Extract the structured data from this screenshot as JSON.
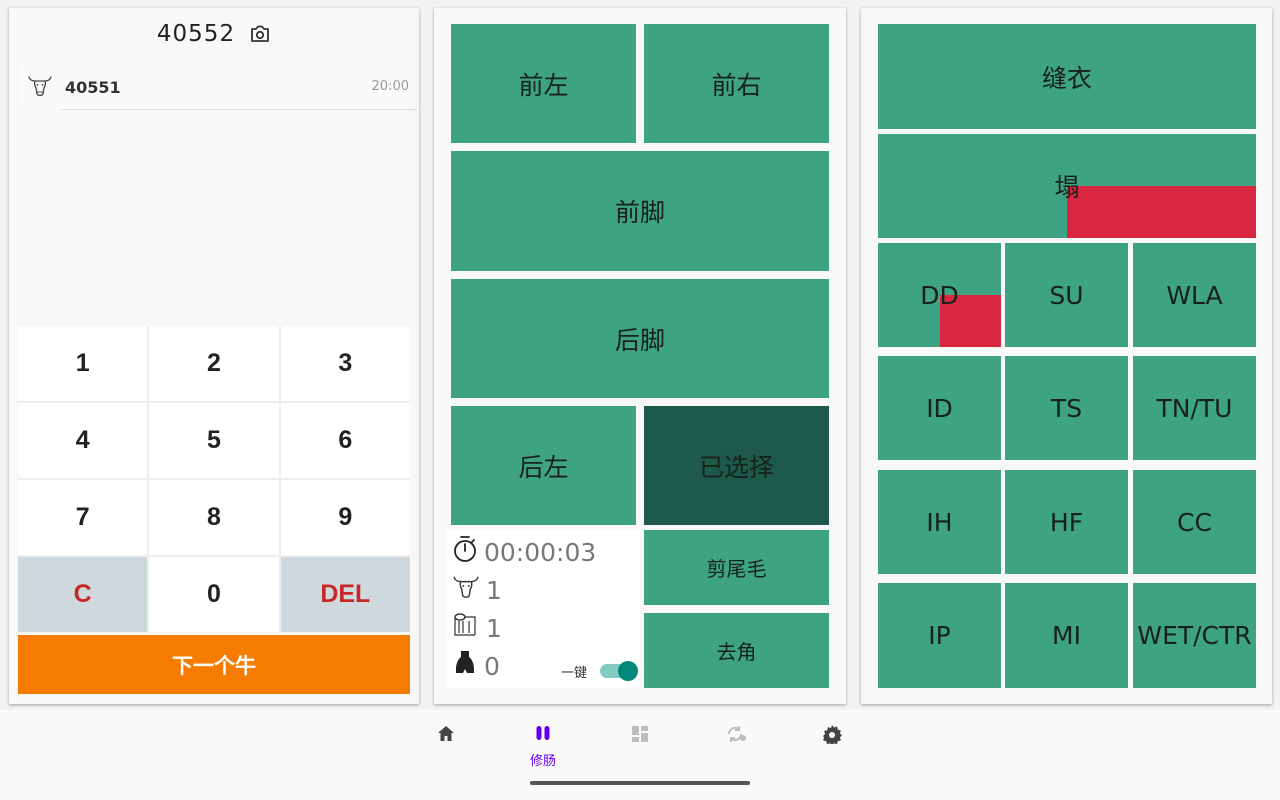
{
  "panel1": {
    "current_id": "40552",
    "entries": [
      {
        "id": "40551",
        "time": "20:00"
      }
    ],
    "keys": [
      "1",
      "2",
      "3",
      "4",
      "5",
      "6",
      "7",
      "8",
      "9",
      "C",
      "0",
      "DEL"
    ],
    "next_label": "下一个牛"
  },
  "panel2": {
    "tiles": {
      "front_left": "前左",
      "front_right": "前右",
      "front_feet": "前脚",
      "rear_feet": "后脚",
      "rear_left": "后左",
      "selected": "已选择",
      "trim_tail": "剪尾毛",
      "dehorn": "去角"
    },
    "stats": {
      "timer": "00:00:03",
      "cows": "1",
      "rolls": "1",
      "hoof": "0"
    },
    "one_key_label": "一键",
    "one_key_on": true
  },
  "panel3": {
    "tiles": {
      "sew": "缝衣",
      "collapse": "塌",
      "dd": "DD",
      "su": "SU",
      "wla": "WLA",
      "id": "ID",
      "ts": "TS",
      "tntu": "TN/TU",
      "ih": "IH",
      "hf": "HF",
      "cc": "CC",
      "ip": "IP",
      "mi": "MI",
      "wetctr": "WET/CTR"
    }
  },
  "nav": {
    "active_label": "修肠"
  },
  "colors": {
    "tile": "#3ea382",
    "tile_selected": "#1d5a4b",
    "flag_red": "#d92641",
    "next_button": "#f57c00",
    "accent": "#6200ee",
    "key_danger": "#c62828"
  },
  "icons": [
    "camera-icon",
    "cow-icon",
    "timer-icon",
    "paper-roll-icon",
    "hoof-icon",
    "home-icon",
    "pause-icon",
    "dashboard-icon",
    "sync-icon",
    "settings-icon"
  ]
}
